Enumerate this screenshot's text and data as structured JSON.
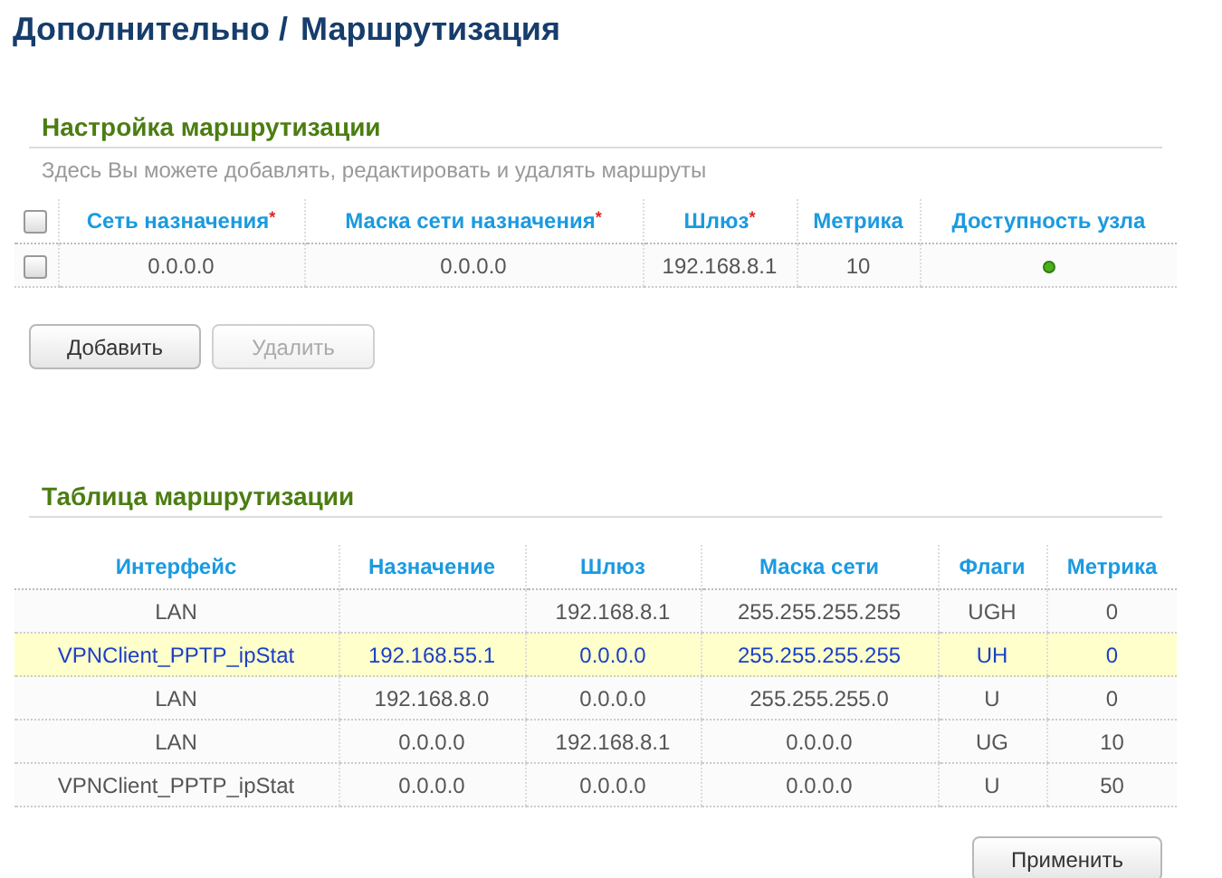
{
  "breadcrumb": {
    "parent": "Дополнительно /",
    "current": "Маршрутизация"
  },
  "routing_settings": {
    "title": "Настройка маршрутизации",
    "description": "Здесь Вы можете добавлять, редактировать и удалять маршруты",
    "select_all": {
      "checked": false
    },
    "columns": [
      {
        "label": "Сеть назначения",
        "required_mark": "*"
      },
      {
        "label": "Маска сети назначения",
        "required_mark": "*"
      },
      {
        "label": "Шлюз",
        "required_mark": "*"
      },
      {
        "label": "Метрика"
      },
      {
        "label": "Доступность узла"
      }
    ],
    "rows": [
      {
        "checked": false,
        "network": "0.0.0.0",
        "mask": "0.0.0.0",
        "gateway": "192.168.8.1",
        "metric": "10",
        "reachable": true
      }
    ],
    "buttons": [
      {
        "label": "Добавить",
        "disabled": false
      },
      {
        "label": "Удалить",
        "disabled": true
      }
    ]
  },
  "routing_table": {
    "title": "Таблица маршрутизации",
    "columns": [
      "Интерфейс",
      "Назначение",
      "Шлюз",
      "Маска сети",
      "Флаги",
      "Метрика"
    ],
    "rows": [
      {
        "selected": false,
        "interface": "LAN",
        "gateway": "192.168.8.1",
        "mask": "255.255.255.255",
        "flags": "UGH",
        "metric": "0"
      },
      {
        "selected": true,
        "interface": "VPNClient_PPTP_ipStat",
        "destination": "192.168.55.1",
        "gateway": "0.0.0.0",
        "mask": "255.255.255.255",
        "flags": "UH",
        "metric": "0"
      },
      {
        "selected": false,
        "interface": "LAN",
        "destination": "192.168.8.0",
        "gateway": "0.0.0.0",
        "mask": "255.255.255.0",
        "flags": "U",
        "metric": "0"
      },
      {
        "selected": false,
        "interface": "LAN",
        "destination": "0.0.0.0",
        "gateway": "192.168.8.1",
        "mask": "0.0.0.0",
        "flags": "UG",
        "metric": "10"
      },
      {
        "selected": false,
        "interface": "VPNClient_PPTP_ipStat",
        "destination": "0.0.0.0",
        "gateway": "0.0.0.0",
        "mask": "0.0.0.0",
        "flags": "U",
        "metric": "50"
      }
    ]
  },
  "apply_button": {
    "label": "Применить",
    "disabled": false
  }
}
